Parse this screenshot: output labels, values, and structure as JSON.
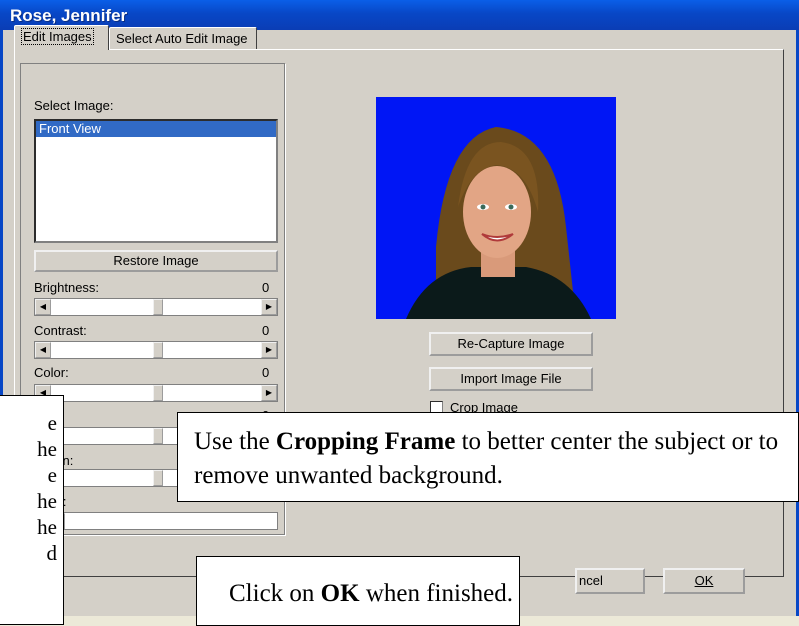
{
  "window": {
    "title": "Rose, Jennifer"
  },
  "tabs": [
    {
      "label": "Edit Images",
      "active": true
    },
    {
      "label": "Select Auto Edit Image",
      "active": false
    }
  ],
  "left_panel": {
    "select_image_label": "Select Image:",
    "list_items": [
      "Front View"
    ],
    "restore_button": "Restore Image",
    "sliders": [
      {
        "label": "Brightness:",
        "value": "0"
      },
      {
        "label": "Contrast:",
        "value": "0"
      },
      {
        "label": "Color:",
        "value": "0"
      },
      {
        "label": "",
        "value": "0"
      },
      {
        "label": "pen:",
        "value": ""
      },
      {
        "label": "m:",
        "value": ""
      }
    ]
  },
  "right_panel": {
    "recapture_button": "Re-Capture Image",
    "import_button": "Import Image File",
    "crop_label": "Crop Image"
  },
  "footer": {
    "cancel_button": "ncel",
    "ok_button": "OK"
  },
  "callouts": {
    "cropping_pre": "Use the ",
    "cropping_bold": "Cropping Frame",
    "cropping_post": " to better center the subject or to remove unwanted background.",
    "ok_pre": "Click on ",
    "ok_bold": "OK",
    "ok_post": " when finished.",
    "left_lines": [
      "e",
      "he",
      "e",
      "he",
      "he",
      "d"
    ]
  },
  "colors": {
    "title_bar": "#0847c6",
    "photo_background": "#0016f5",
    "selection": "#316ac5"
  }
}
